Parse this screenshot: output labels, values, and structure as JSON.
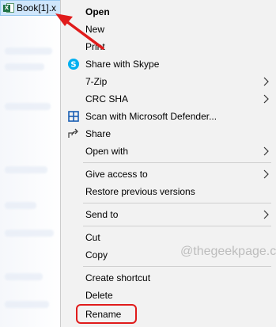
{
  "file": {
    "name": "Book[1].x",
    "icon": "excel-file-icon"
  },
  "menu": {
    "open": "Open",
    "new": "New",
    "print": "Print",
    "skype": "Share with Skype",
    "zip": "7-Zip",
    "crc": "CRC SHA",
    "defender": "Scan with Microsoft Defender...",
    "share": "Share",
    "open_with": "Open with",
    "give_access": "Give access to",
    "restore": "Restore previous versions",
    "send_to": "Send to",
    "cut": "Cut",
    "copy": "Copy",
    "create_shortcut": "Create shortcut",
    "delete": "Delete",
    "rename": "Rename"
  },
  "watermark": "@thegeekpage.com",
  "colors": {
    "menu_bg": "#f2f2f2",
    "highlight": "#e01b1b",
    "selection": "#cfe6fb"
  }
}
